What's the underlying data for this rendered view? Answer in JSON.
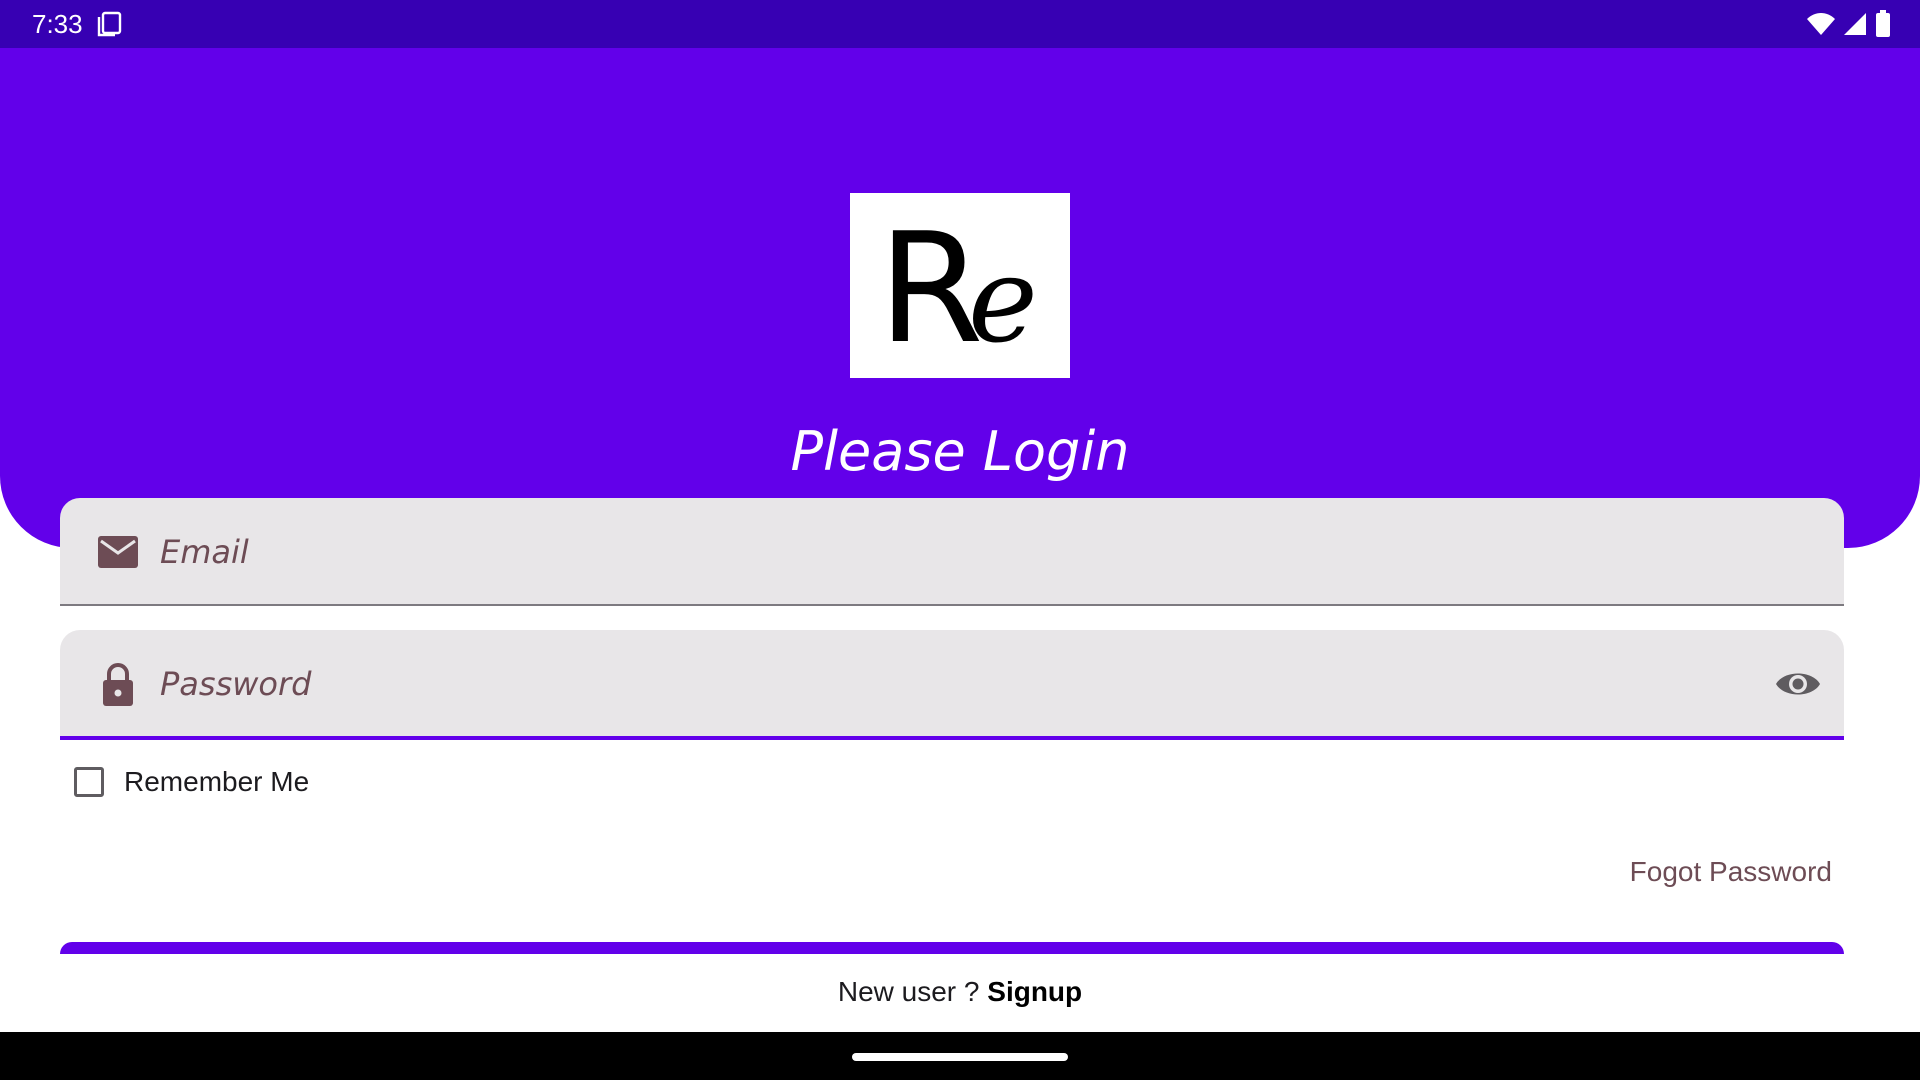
{
  "status_bar": {
    "time": "7:33",
    "icons": [
      "notification-icon",
      "wifi-icon",
      "signal-icon",
      "battery-icon"
    ]
  },
  "header": {
    "logo_text": "Re",
    "title": "Please Login"
  },
  "form": {
    "email": {
      "placeholder": "Email",
      "value": "",
      "icon": "mail-icon"
    },
    "password": {
      "placeholder": "Password",
      "value": "",
      "icon": "lock-icon",
      "toggle_icon": "eye-icon"
    },
    "remember_me": {
      "label": "Remember Me",
      "checked": false
    },
    "forgot_label": "Fogot Password",
    "signup_prefix": "New user ? ",
    "signup_link": "Signup"
  },
  "colors": {
    "primary": "#6200ea",
    "status_bar": "#3700b3",
    "field_bg": "#e8e6e8",
    "field_text": "#6d4c55"
  }
}
